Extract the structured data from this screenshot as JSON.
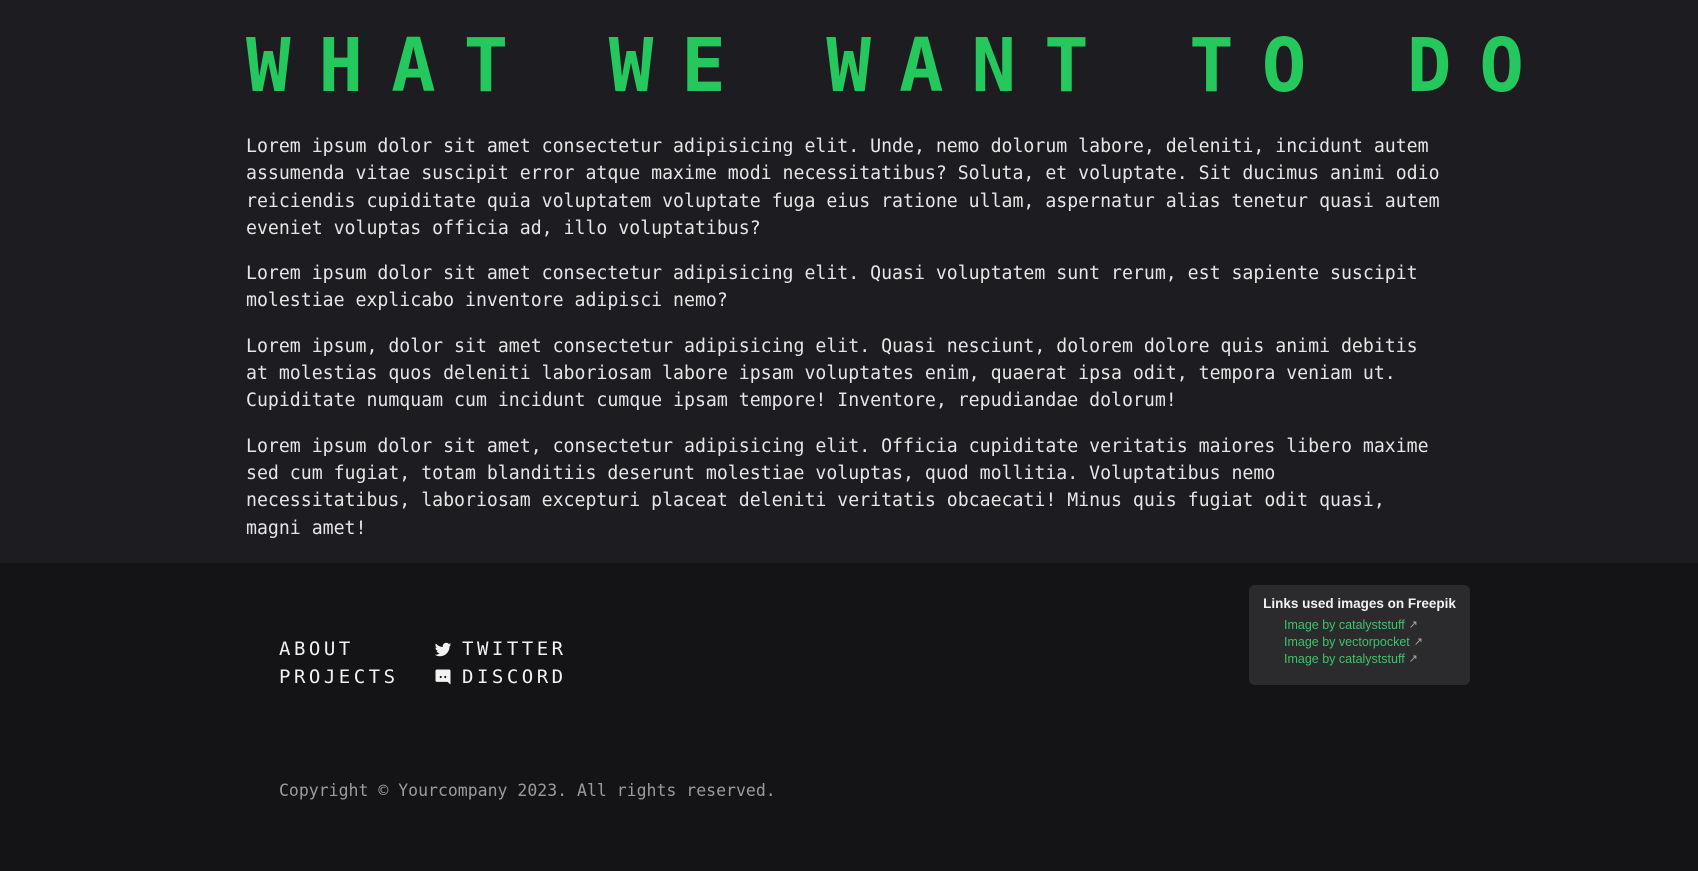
{
  "what_section": {
    "heading": "WHAT WE WANT TO DO",
    "heading_color": "#25c85d",
    "paragraphs": [
      "Lorem ipsum dolor sit amet consectetur adipisicing elit. Unde, nemo dolorum labore, deleniti, incidunt autem assumenda vitae suscipit error atque maxime modi necessitatibus? Soluta, et voluptate. Sit ducimus animi odio reiciendis cupiditate quia voluptatem voluptate fuga eius ratione ullam, aspernatur alias tenetur quasi autem eveniet voluptas officia ad, illo voluptatibus?",
      "Lorem ipsum dolor sit amet consectetur adipisicing elit. Quasi voluptatem sunt rerum, est sapiente suscipit molestiae explicabo inventore adipisci nemo?",
      "Lorem ipsum, dolor sit amet consectetur adipisicing elit. Quasi nesciunt, dolorem dolore quis animi debitis at molestias quos deleniti laboriosam labore ipsam voluptates enim, quaerat ipsa odit, tempora veniam ut. Cupiditate numquam cum incidunt cumque ipsam tempore! Inventore, repudiandae dolorum!",
      "Lorem ipsum dolor sit amet, consectetur adipisicing elit. Officia cupiditate veritatis maiores libero maxime sed cum fugiat, totam blanditiis deserunt molestiae voluptas, quod mollitia. Voluptatibus nemo necessitatibus, laboriosam excepturi placeat deleniti veritatis obcaecati! Minus quis fugiat odit quasi, magni amet!"
    ]
  },
  "footer": {
    "nav": {
      "about": "ABOUT",
      "projects": "PROJECTS"
    },
    "social": {
      "twitter": {
        "label": "TWITTER",
        "icon": "twitter-icon"
      },
      "discord": {
        "label": "DISCORD",
        "icon": "discord-icon"
      }
    },
    "credits": {
      "title": "Links used images on Freepik",
      "links": [
        "Image by catalyststuff",
        "Image by vectorpocket",
        "Image by catalyststuff"
      ],
      "link_color": "#3ec26a",
      "external_icon": "external-link-icon"
    },
    "copyright": "Copyright © Yourcompany 2023. All rights reserved."
  }
}
